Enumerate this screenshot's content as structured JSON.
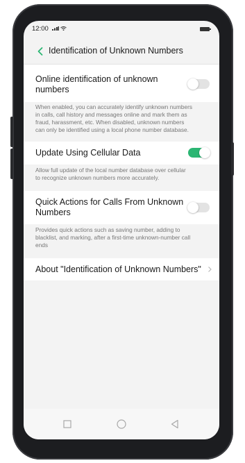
{
  "status_bar": {
    "time": "12:00",
    "icons": [
      "signal-icon",
      "wifi-icon",
      "battery-icon"
    ]
  },
  "header": {
    "back_icon": "chevron-left-icon",
    "title": "Identification of Unknown Numbers",
    "accent_color": "#2bb673"
  },
  "settings": {
    "online_id": {
      "label_line1": "Online identification of unknown",
      "label_line2": "numbers",
      "enabled": false,
      "description_lines": [
        "When enabled, you can accurately identify unknown numbers",
        "in calls, call history and messages online and mark them as",
        "fraud, harassment, etc. When disabled, unknown numbers",
        "can only be identified using a local phone number database."
      ]
    },
    "cellular_update": {
      "label": "Update Using Cellular Data",
      "enabled": true,
      "description_lines": [
        "Allow full update of the local number database over cellular",
        "to recognize unknown numbers more accurately."
      ]
    },
    "quick_actions": {
      "label_line1": "Quick Actions for Calls From Unknown",
      "label_line2": "Numbers",
      "enabled": false,
      "description_lines": [
        "Provides quick actions such as saving number, adding to",
        "blacklist, and marking, after a first-time unknown-number call",
        "ends"
      ]
    },
    "about": {
      "label": "About \"Identification of Unknown Numbers\"",
      "icon": "chevron-right-icon"
    }
  },
  "nav_bar": {
    "icons": [
      "recent-apps-icon",
      "home-icon",
      "back-icon"
    ]
  }
}
